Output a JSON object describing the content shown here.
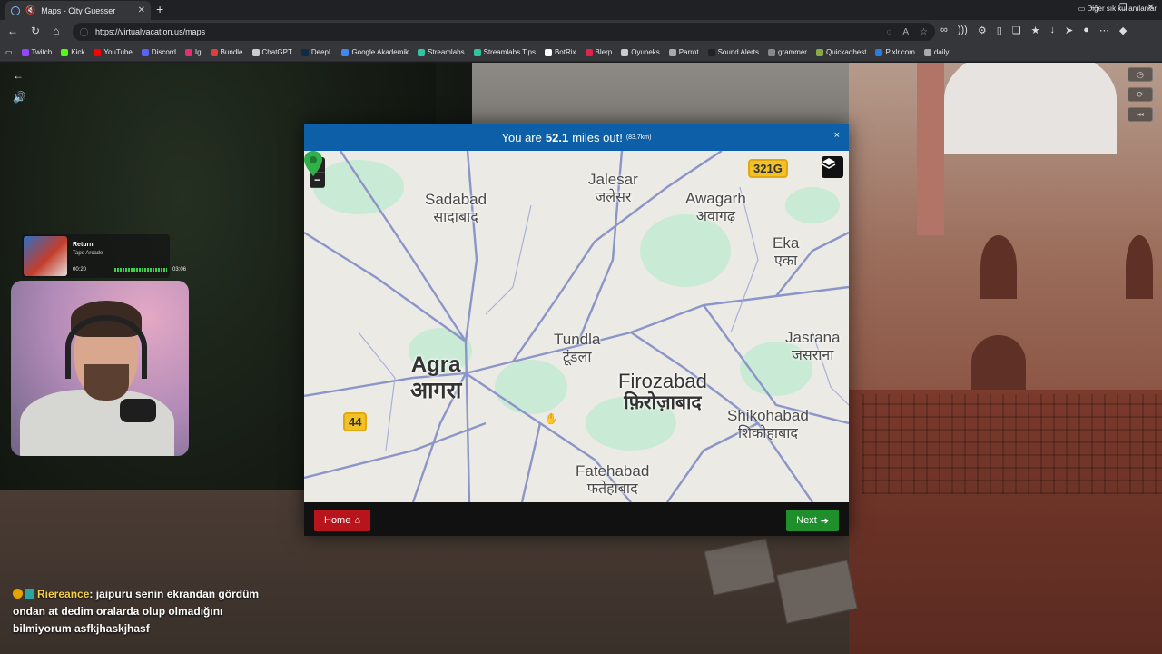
{
  "browser": {
    "tab_title": "Maps - City Guesser",
    "url": "https://virtualvacation.us/maps",
    "bookmarks": [
      {
        "label": "Twitch",
        "color": "#9146ff"
      },
      {
        "label": "Kick",
        "color": "#53fc18"
      },
      {
        "label": "YouTube",
        "color": "#ff0000"
      },
      {
        "label": "Discord",
        "color": "#5865f2"
      },
      {
        "label": "Ig",
        "color": "#e1306c"
      },
      {
        "label": "Bundle",
        "color": "#e03c3c"
      },
      {
        "label": "ChatGPT",
        "color": "#cccccc"
      },
      {
        "label": "DeepL",
        "color": "#0f2b46"
      },
      {
        "label": "Google Akademik",
        "color": "#4285f4"
      },
      {
        "label": "Streamlabs",
        "color": "#31c3a2"
      },
      {
        "label": "Streamlabs Tips",
        "color": "#31c3a2"
      },
      {
        "label": "BotRix",
        "color": "#ffffff"
      },
      {
        "label": "Blerp",
        "color": "#e0234e"
      },
      {
        "label": "Oyuneks",
        "color": "#cccccc"
      },
      {
        "label": "Parrot",
        "color": "#aaaaaa"
      },
      {
        "label": "Sound Alerts",
        "color": "#222222"
      },
      {
        "label": "grammer",
        "color": "#888888"
      },
      {
        "label": "Quickadbest",
        "color": "#88aa44"
      },
      {
        "label": "Pixlr.com",
        "color": "#2a7de1"
      },
      {
        "label": "daily",
        "color": "#aaaaaa"
      }
    ],
    "other_bookmarks": "Diğer sık kullanılanlar"
  },
  "music": {
    "song": "Return",
    "artist": "Tape Arcade",
    "elapsed": "00:20",
    "duration": "03:06"
  },
  "chat": {
    "user": "Riereance",
    "message": ": jaipuru senin ekrandan gördüm ondan at dedim oralarda olup olmadığını bilmiyorum asfkjhaskjhasf"
  },
  "modal": {
    "prefix": "You are",
    "distance": "52.1",
    "suffix": "miles out!",
    "km": "(83.7km)",
    "close": "×",
    "home_label": "Home",
    "next_label": "Next"
  },
  "map": {
    "zoom_in": "+",
    "zoom_out": "−",
    "places": [
      {
        "key": "sadabad",
        "en": "Sadabad",
        "hi": "सादाबाद"
      },
      {
        "key": "jalesar",
        "en": "Jalesar",
        "hi": "जलेसर"
      },
      {
        "key": "awagarh",
        "en": "Awagarh",
        "hi": "अवागढ़"
      },
      {
        "key": "eka",
        "en": "Eka",
        "hi": "एका"
      },
      {
        "key": "tundla",
        "en": "Tundla",
        "hi": "टूंडला"
      },
      {
        "key": "jasrana",
        "en": "Jasrana",
        "hi": "जसराना"
      },
      {
        "key": "agra",
        "en": "Agra",
        "hi": "आगरा"
      },
      {
        "key": "firozabad",
        "en": "Firozabad",
        "hi": "फ़िरोज़ाबाद"
      },
      {
        "key": "shikohabad",
        "en": "Shikohabad",
        "hi": "शिकोहाबाद"
      },
      {
        "key": "fatehabad",
        "en": "Fatehabad",
        "hi": "फतेहाबाद"
      }
    ],
    "shields": [
      "321G",
      "44"
    ]
  }
}
